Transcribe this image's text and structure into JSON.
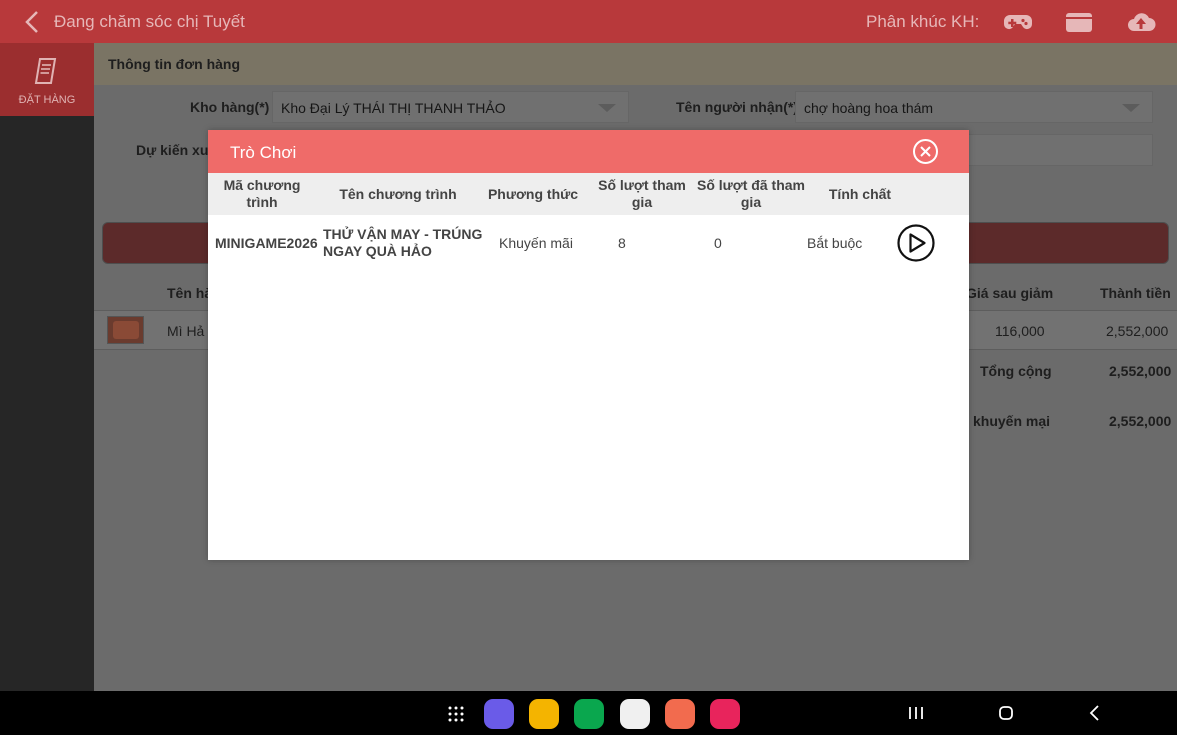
{
  "topbar": {
    "title": "Đang chăm sóc chị Tuyết",
    "segment_label": "Phân khúc KH:",
    "icons": [
      "back-chevron-icon",
      "gamepad-icon",
      "wallet-icon",
      "cloud-upload-icon"
    ]
  },
  "rail": {
    "tab_label": "ĐẶT HÀNG",
    "tab_icon": "order-document-icon"
  },
  "order_info": {
    "header": "Thông tin đơn hàng",
    "warehouse_label": "Kho hàng(*)",
    "warehouse_value": "Kho Đại Lý THÁI THỊ THANH THẢO",
    "recipient_label": "Tên người nhận(*)",
    "recipient_value": "chợ hoàng hoa thám",
    "expected_label": "Dự kiến xuấ"
  },
  "products_table": {
    "col_name": "Tên hà",
    "col_price_after": "Giá sau giảm",
    "col_total": "Thành tiền",
    "row": {
      "name": "Mì Hả",
      "price_after": "116,000",
      "total": "2,552,000"
    },
    "sum_label": "Tổng cộng",
    "sum_value": "2,552,000",
    "promo_label": "khuyến mại",
    "promo_value": "2,552,000"
  },
  "modal": {
    "title": "Trò Chơi",
    "headers": [
      "Mã chương trình",
      "Tên chương trình",
      "Phương thức",
      "Số lượt tham gia",
      "Số lượt đã tham gia",
      "Tính chất"
    ],
    "rows": [
      {
        "code": "MINIGAME2026",
        "name": "THỬ VẬN MAY - TRÚNG NGAY QUÀ HẢO",
        "method": "Khuyến mãi",
        "turns": "8",
        "used": "0",
        "type": "Bắt buộc"
      }
    ]
  },
  "android_nav": {
    "apps": [
      "app-drawer-icon",
      "internet-app-icon",
      "files-app-icon",
      "phone-app-icon",
      "messages-app-icon",
      "contacts-app-icon",
      "camera-app-icon"
    ],
    "buttons": [
      "recents-button",
      "home-button",
      "back-button"
    ]
  },
  "colors": {
    "topbar": "#b8393b",
    "modal_header": "#ef6b69",
    "rail_tab": "#9b2e2f"
  }
}
